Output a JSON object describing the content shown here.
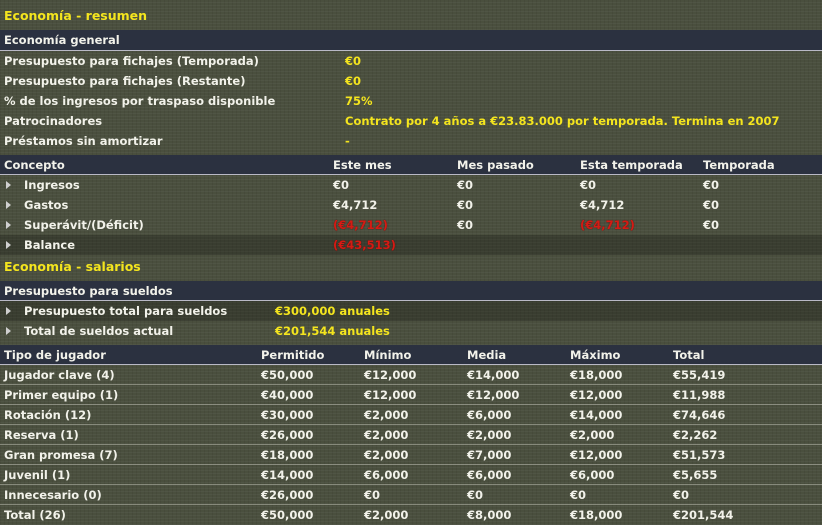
{
  "economy_title": "Economía - resumen",
  "general": {
    "header": "Economía general",
    "rows": [
      {
        "label": "Presupuesto para fichajes (Temporada)",
        "value": "€0"
      },
      {
        "label": "Presupuesto para fichajes (Restante)",
        "value": "€0"
      },
      {
        "label": "% de los ingresos por traspaso disponible",
        "value": "75%"
      },
      {
        "label": "Patrocinadores",
        "value": "Contrato por 4 años a €23.83.000 por temporada. Termina en 2007"
      },
      {
        "label": "Préstamos sin amortizar",
        "value": "-"
      }
    ]
  },
  "concept": {
    "headers": [
      "Concepto",
      "Este mes",
      "Mes pasado",
      "Esta temporada",
      "Temporada"
    ],
    "rows": [
      {
        "label": "Ingresos",
        "cells": [
          "€0",
          "€0",
          "€0",
          "€0"
        ]
      },
      {
        "label": "Gastos",
        "cells": [
          "€4,712",
          "€0",
          "€4,712",
          "€0"
        ]
      },
      {
        "label": "Superávit/(Déficit)",
        "cells": [
          "(€4,712)",
          "€0",
          "(€4,712)",
          "€0"
        ]
      },
      {
        "label": "Balance",
        "cells": [
          "(€43,513)",
          "",
          "",
          ""
        ]
      }
    ]
  },
  "salary_title": "Economía - salarios",
  "budget": {
    "header": "Presupuesto para sueldos",
    "rows": [
      {
        "label": "Presupuesto total para sueldos",
        "value": "€300,000 anuales"
      },
      {
        "label": "Total de sueldos actual",
        "value": "€201,544 anuales"
      }
    ]
  },
  "players": {
    "headers": [
      "Tipo de jugador",
      "Permitido",
      "Mínimo",
      "Media",
      "Máximo",
      "Total"
    ],
    "rows": [
      [
        "Jugador clave (4)",
        "€50,000",
        "€12,000",
        "€14,000",
        "€18,000",
        "€55,419"
      ],
      [
        "Primer equipo (1)",
        "€40,000",
        "€12,000",
        "€12,000",
        "€12,000",
        "€11,988"
      ],
      [
        "Rotación (12)",
        "€30,000",
        "€2,000",
        "€6,000",
        "€14,000",
        "€74,646"
      ],
      [
        "Reserva (1)",
        "€26,000",
        "€2,000",
        "€2,000",
        "€2,000",
        "€2,262"
      ],
      [
        "Gran promesa (7)",
        "€18,000",
        "€2,000",
        "€7,000",
        "€12,000",
        "€51,573"
      ],
      [
        "Juvenil (1)",
        "€14,000",
        "€6,000",
        "€6,000",
        "€6,000",
        "€5,655"
      ],
      [
        "Innecesario (0)",
        "€26,000",
        "€0",
        "€0",
        "€0",
        "€0"
      ],
      [
        "Total  (26)",
        "€50,000",
        "€2,000",
        "€8,000",
        "€18,000",
        "€201,544"
      ]
    ]
  },
  "colors": {
    "accent": "#f4e51e",
    "negative": "#d41b14",
    "header_bg": "#2b3140"
  }
}
